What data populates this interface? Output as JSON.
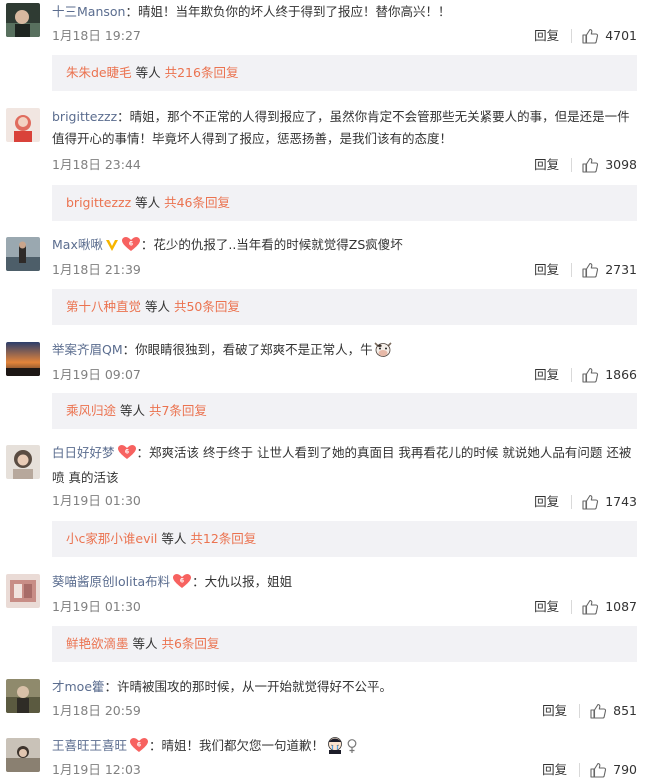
{
  "comments": [
    {
      "username": "十三Manson",
      "text": "：晴姐！当年欺负你的坏人终于得到了报应！替你高兴！！",
      "time": "1月18日 19:27",
      "reply_label": "回复",
      "likes": "4701",
      "sub": {
        "users": "朱朱de睫毛",
        "mid": " 等人 ",
        "count": "共216条回复"
      },
      "avatar_color": "#3a4a3f"
    },
    {
      "username": "brigittezzz",
      "text": "：晴姐，那个不正常的人得到报应了，虽然你肯定不会管那些无关紧要人的事，但是还是一件值得开心的事情！毕竟坏人得到了报应，惩恶扬善，是我们该有的态度！",
      "time": "1月18日 23:44",
      "reply_label": "回复",
      "likes": "3098",
      "sub": {
        "users": "brigittezzz",
        "mid": " 等人 ",
        "count": "共46条回复"
      },
      "avatar_color": "#e86a5c"
    },
    {
      "username": "Max啾啾",
      "text": "：花少的仇报了..当年看的时候就觉得ZS疯傻坏",
      "time": "1月18日 21:39",
      "reply_label": "回复",
      "likes": "2731",
      "sub": {
        "users": "第十八种直觉",
        "mid": " 等人 ",
        "count": "共50条回复"
      },
      "avatar_color": "#6b7c86"
    },
    {
      "username": "举案齐眉QM",
      "text": "：你眼睛很独到，看破了郑爽不是正常人，牛",
      "time": "1月19日 09:07",
      "reply_label": "回复",
      "likes": "1866",
      "sub": {
        "users": "乘风归途",
        "mid": " 等人 ",
        "count": "共7条回复"
      },
      "avatar_color": "#d9793a"
    },
    {
      "username": "白日好好梦",
      "text": "：郑爽活该   终于终于 让世人看到了她的真面目  我再看花儿的时候 就说她人品有问题  还被 喷  真的活该",
      "time": "1月19日 01:30",
      "reply_label": "回复",
      "likes": "1743",
      "sub": {
        "users": "小c家那小谁evil",
        "mid": " 等人 ",
        "count": "共12条回复"
      },
      "avatar_color": "#8a7b6e"
    },
    {
      "username": "葵喵酱原创lolita布料",
      "text": "：大仇以报，姐姐",
      "time": "1月19日 01:30",
      "reply_label": "回复",
      "likes": "1087",
      "sub": {
        "users": "鲜艳欲滴墨",
        "mid": " 等人 ",
        "count": "共6条回复"
      },
      "avatar_color": "#c98f8a"
    },
    {
      "username": "才moe籗",
      "text": "：许晴被围攻的那时候，从一开始就觉得好不公平。",
      "time": "1月18日 20:59",
      "reply_label": "回复",
      "likes": "851"
    },
    {
      "username": "王喜旺王喜旺",
      "text": "：晴姐！我们都欠您一句道歉！",
      "time": "1月19日 12:03",
      "reply_label": "回复",
      "likes": "790"
    }
  ],
  "colors": {
    "link": "#eb7350",
    "name_blue": "#5b6d8f",
    "sub_bg": "#f2f2f5",
    "meta": "#808080"
  }
}
